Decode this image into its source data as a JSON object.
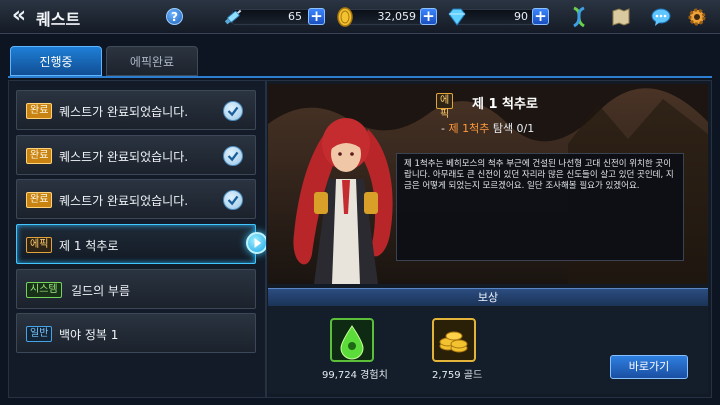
{
  "header": {
    "back_icon": "double-chevron-left-icon",
    "title": "퀘스트",
    "help_label": "?"
  },
  "resources": [
    {
      "name": "stamina",
      "icon": "syringe-icon",
      "value": "65",
      "plus": "+"
    },
    {
      "name": "gold",
      "icon": "gold-coin-icon",
      "value": "32,059",
      "plus": "+"
    },
    {
      "name": "gem",
      "icon": "diamond-icon",
      "value": "90",
      "plus": "+"
    }
  ],
  "top_icons": [
    "dna-icon",
    "map-icon",
    "chat-icon",
    "gear-icon"
  ],
  "tabs": [
    {
      "label": "진행중",
      "active": true
    },
    {
      "label": "에픽완료",
      "active": false
    }
  ],
  "quests": [
    {
      "badge": "완료",
      "type": "done",
      "label": "퀘스트가 완료되었습니다.",
      "checked": true
    },
    {
      "badge": "완료",
      "type": "done",
      "label": "퀘스트가 완료되었습니다.",
      "checked": true
    },
    {
      "badge": "완료",
      "type": "done",
      "label": "퀘스트가 완료되었습니다.",
      "checked": true
    },
    {
      "badge": "에픽",
      "type": "epic",
      "label": "제 1 척추로",
      "checked": false,
      "selected": true
    },
    {
      "badge": "시스템",
      "type": "system",
      "label": "길드의 부름",
      "checked": false
    },
    {
      "badge": "일반",
      "type": "normal",
      "label": "백야 정복 1",
      "checked": false
    }
  ],
  "detail": {
    "badge": "에픽",
    "title": "제 1 척추로",
    "objective_prefix": "- ",
    "objective_highlight": "제 1척추",
    "objective_rest": " 탐색 0/1",
    "description": "제 1척추는 베히모스의 척추 부근에 건설된 나선형 고대 신전이 위치한 곳이랍니다. 아무래도 큰 신전이 있던 자리라 많은 신도들이 살고 있던 곳인데, 지금은 어떻게 되었는지 모르겠어요. 일단 조사해볼 필요가 있겠어요."
  },
  "reward": {
    "header": "보상",
    "items": [
      {
        "icon": "exp-drop-icon",
        "label": "99,724 경험치"
      },
      {
        "icon": "gold-coins-icon",
        "label": "2,759 골드"
      }
    ],
    "go_button": "바로가기"
  },
  "colors": {
    "accent": "#2c7ed0",
    "done_badge": "#c98312",
    "epic_badge": "#e2a33a",
    "system_badge": "#72d45a",
    "normal_badge": "#46a4e6",
    "highlight": "#ff9a3c"
  }
}
